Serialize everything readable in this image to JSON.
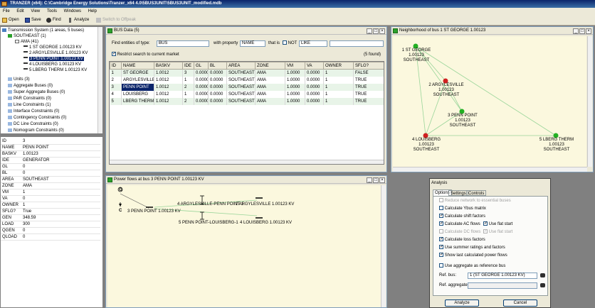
{
  "app": {
    "title": "TRANZER (x64): C:\\Cambridge Energy Solutions\\Tranzer_x64 4.0\\5BUS3UNIT\\5BUS3UNIT_modified.mdb"
  },
  "menu": [
    "File",
    "Edit",
    "View",
    "Tools",
    "Windows",
    "Help"
  ],
  "toolbar": {
    "open": "Open",
    "save": "Save",
    "find": "Find",
    "analyze": "Analyze",
    "switch": "Switch to Offpeak"
  },
  "tree": {
    "root": "Transmission System (1 areas, 5 buses)",
    "southeast": "SOUTHEAST (1)",
    "ama": "AMA (41)",
    "buses": [
      "1 ST GEORGE 1.00123 KV",
      "2 ARGYLESVILLE 1.00123 KV",
      "3 PENN POINT 1.00123 KV",
      "4 LOUISBERG 1.00123 KV",
      "5 LBERG THERM 1.00123 KV"
    ],
    "others": [
      "Units (3)",
      "Aggregate Buses (0)",
      "Super Aggregate Buses (0)",
      "PAR Constraints (0)",
      "Line Constraints (1)",
      "Interface Constraints (0)",
      "Contingency Constraints (0)",
      "DC Line Constraints (0)",
      "Nomogram Constraints (0)"
    ]
  },
  "properties": [
    {
      "k": "ID",
      "v": "3"
    },
    {
      "k": "NAME",
      "v": "PENN POINT"
    },
    {
      "k": "BASKV",
      "v": "1.00123"
    },
    {
      "k": "IDE",
      "v": "GENERATOR"
    },
    {
      "k": "GL",
      "v": "0"
    },
    {
      "k": "BL",
      "v": "0"
    },
    {
      "k": "AREA",
      "v": "SOUTHEAST"
    },
    {
      "k": "ZONE",
      "v": "AMA"
    },
    {
      "k": "VM",
      "v": "1"
    },
    {
      "k": "VA",
      "v": "0"
    },
    {
      "k": "OWNER",
      "v": "1"
    },
    {
      "k": "SFLG?",
      "v": "True"
    },
    {
      "k": "GEN",
      "v": "348.59"
    },
    {
      "k": "LOAD",
      "v": "300"
    },
    {
      "k": "QGEN",
      "v": "0"
    },
    {
      "k": "QLOAD",
      "v": "0"
    }
  ],
  "busdata": {
    "title": "BUS Data (5)",
    "find_label": "Find entities of type:",
    "type_value": "BUS",
    "with_property": "with property",
    "property_value": "NAME",
    "that_is": "that is",
    "not_label": "NOT",
    "op_value": "LIKE",
    "restrict_label": "Restrict search to current market",
    "found": "(5 found)",
    "columns": [
      "ID",
      "NAME",
      "BASKV",
      "IDE",
      "GL",
      "BL",
      "AREA",
      "ZONE",
      "VM",
      "VA",
      "OWNER",
      "SFLG?"
    ],
    "rows": [
      [
        "1",
        "ST GEORGE",
        "1.0012",
        "3",
        "0.0000",
        "0.0000",
        "SOUTHEAST",
        "AMA",
        "1.0000",
        "0.0000",
        "1",
        "FALSE"
      ],
      [
        "2",
        "ARGYLESVILLE",
        "1.0012",
        "1",
        "0.0000",
        "0.0000",
        "SOUTHEAST",
        "AMA",
        "1.0000",
        "0.0000",
        "1",
        "TRUE"
      ],
      [
        "3",
        "PENN POINT",
        "1.0012",
        "2",
        "0.0000",
        "0.0000",
        "SOUTHEAST",
        "AMA",
        "1.0000",
        "0.0000",
        "1",
        "TRUE"
      ],
      [
        "4",
        "LOUISBERG",
        "1.0012",
        "1",
        "0.0000",
        "0.0000",
        "SOUTHEAST",
        "AMA",
        "1.0000",
        "0.0000",
        "1",
        "TRUE"
      ],
      [
        "5",
        "LBERG THERM",
        "1.0012",
        "2",
        "0.0000",
        "0.0000",
        "SOUTHEAST",
        "AMA",
        "1.0000",
        "0.0000",
        "1",
        "TRUE"
      ]
    ]
  },
  "neighborhood": {
    "title": "Neighborhood of bus 1 ST GEORGE 1.00123",
    "nodes": [
      {
        "label": "1 ST GEORGE 1.00123",
        "area": "SOUTHEAST",
        "color": "#22b022"
      },
      {
        "label": "2 ARGYLESVILLE 1.00123",
        "area": "SOUTHEAST",
        "color": "#d02020"
      },
      {
        "label": "3 PENN POINT 1.00123",
        "area": "SOUTHEAST",
        "color": "#22b022"
      },
      {
        "label": "4 LOUISBERG 1.00123",
        "area": "SOUTHEAST",
        "color": "#d02020"
      },
      {
        "label": "5 LBERG THERM 1.00123",
        "area": "SOUTHEAST",
        "color": "#22b022"
      }
    ]
  },
  "powerflow": {
    "title": "Power flows at bus 3 PENN POINT 1.00123 KV",
    "bus": "3 PENN POINT 1.00123 KV",
    "gen_label": "G",
    "load_label": "C",
    "line1": "4 ARGYLESVILLE-PENN POINT-1",
    "to1": "2 ARGYLESVILLE 1.00123 KV",
    "line2": "5 PENN POINT-LOUISBERG-1",
    "to2": "4 LOUISBERG 1.00123 KV"
  },
  "analysis": {
    "title": "Analysis",
    "tabs": [
      "Options",
      "Settings",
      "Controls"
    ],
    "options": [
      {
        "label": "Reduce network to essential buses",
        "checked": false,
        "disabled": true
      },
      {
        "label": "Calculate Ybus matrix",
        "checked": false,
        "disabled": false
      },
      {
        "label": "Calculate shift factors",
        "checked": true,
        "disabled": false
      },
      {
        "label": "Calculate AC flows",
        "checked": true,
        "disabled": false
      },
      {
        "label": "Calculate DC flows",
        "checked": false,
        "disabled": true
      },
      {
        "label": "Calculate loss factors",
        "checked": true,
        "disabled": false
      },
      {
        "label": "Use summer ratings and factors",
        "checked": true,
        "disabled": false
      },
      {
        "label": "Show last calculated power flows",
        "checked": true,
        "disabled": false
      }
    ],
    "flat1": "Use flat start",
    "flat2": "Use flat start",
    "aggregate": "Use aggregate as reference bus",
    "ref_bus_label": "Ref. bus:",
    "ref_bus_value": "1 (ST GEORGE 1.00123 KV)",
    "ref_agg_label": "Ref. aggregate:",
    "analyze_btn": "Analyze",
    "cancel_btn": "Cancel"
  }
}
